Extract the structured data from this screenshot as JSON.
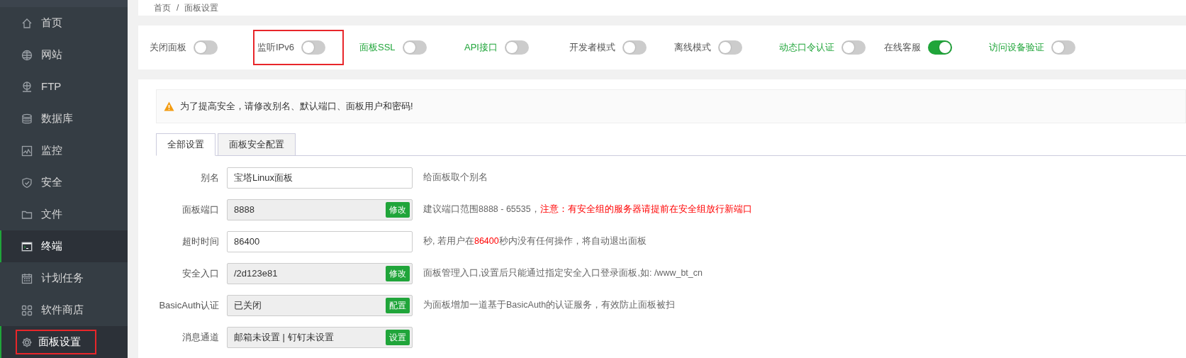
{
  "sidebar": {
    "items": [
      {
        "label": "首页",
        "selected": false,
        "highlighted": false
      },
      {
        "label": "网站",
        "selected": false,
        "highlighted": false
      },
      {
        "label": "FTP",
        "selected": false,
        "highlighted": false
      },
      {
        "label": "数据库",
        "selected": false,
        "highlighted": false
      },
      {
        "label": "监控",
        "selected": false,
        "highlighted": false
      },
      {
        "label": "安全",
        "selected": false,
        "highlighted": false
      },
      {
        "label": "文件",
        "selected": false,
        "highlighted": false
      },
      {
        "label": "终端",
        "selected": true,
        "highlighted": false
      },
      {
        "label": "计划任务",
        "selected": false,
        "highlighted": false
      },
      {
        "label": "软件商店",
        "selected": false,
        "highlighted": false
      },
      {
        "label": "面板设置",
        "selected": true,
        "highlighted": true
      }
    ]
  },
  "breadcrumb": [
    "首页",
    "/",
    "面板设置"
  ],
  "toggles": [
    {
      "label": "关闭面板",
      "on": false,
      "color": "#555555",
      "highlighted": false
    },
    {
      "label": "监听IPv6",
      "on": false,
      "color": "#555555",
      "highlighted": true
    },
    {
      "label": "面板SSL",
      "on": false,
      "color": "#20a53a",
      "highlighted": false
    },
    {
      "label": "API接口",
      "on": false,
      "color": "#20a53a",
      "highlighted": false
    },
    {
      "label": "开发者模式",
      "on": false,
      "color": "#555555",
      "highlighted": false
    },
    {
      "label": "离线模式",
      "on": false,
      "color": "#555555",
      "highlighted": false
    },
    {
      "label": "动态口令认证",
      "on": false,
      "color": "#20a53a",
      "highlighted": false
    },
    {
      "label": "在线客服",
      "on": true,
      "color": "#555555",
      "highlighted": false
    },
    {
      "label": "访问设备验证",
      "on": false,
      "color": "#20a53a",
      "highlighted": false
    }
  ],
  "alert": "为了提高安全，请修改别名、默认端口、面板用户和密码!",
  "tabs": [
    {
      "label": "全部设置",
      "selected": true
    },
    {
      "label": "面板安全配置",
      "selected": false
    }
  ],
  "form": [
    {
      "label": "别名",
      "value": "宝塔Linux面板",
      "readonly": false,
      "help": [
        {
          "text": "给面板取个别名",
          "warning": false
        }
      ]
    },
    {
      "label": "面板端口",
      "value": "8888",
      "readonly": true,
      "button": "修改",
      "help": [
        {
          "text": "建议端口范围8888 - 65535，",
          "warning": false
        },
        {
          "text": "注意：有安全组的服务器请提前在安全组放行新端口",
          "warning": true
        }
      ]
    },
    {
      "label": "超时时间",
      "value": "86400",
      "readonly": false,
      "help": [
        {
          "text": "秒, 若用户在",
          "warning": false
        },
        {
          "text": "86400",
          "warning": true
        },
        {
          "text": "秒内没有任何操作，将自动退出面板",
          "warning": false
        }
      ]
    },
    {
      "label": "安全入口",
      "value": "/2d123e81",
      "readonly": true,
      "button": "修改",
      "help": [
        {
          "text": "面板管理入口,设置后只能通过指定安全入口登录面板,如: /www_bt_cn",
          "warning": false
        }
      ]
    },
    {
      "label": "BasicAuth认证",
      "value": "已关闭",
      "readonly": true,
      "button": "配置",
      "help": [
        {
          "text": "为面板增加一道基于BasicAuth的认证服务，有效防止面板被扫",
          "warning": false
        }
      ]
    },
    {
      "label": "消息通道",
      "value": "邮箱未设置 | 钉钉未设置",
      "readonly": true,
      "button": "设置"
    }
  ]
}
